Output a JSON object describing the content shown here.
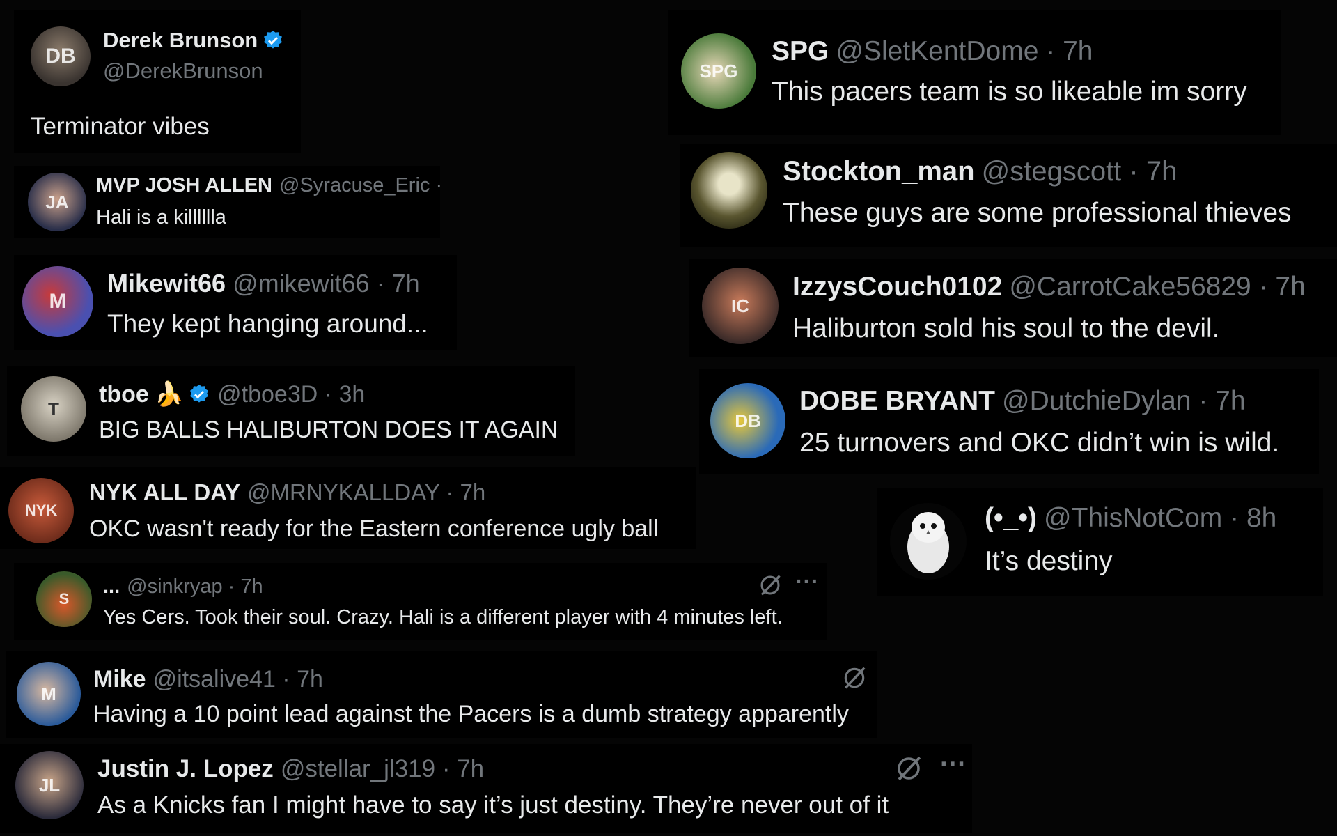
{
  "left": [
    {
      "name": "Derek Brunson",
      "handle": "@DerekBrunson",
      "text": "Terminator vibes",
      "verified": true,
      "avatar_color": "#4a4440"
    },
    {
      "name": "MVP JOSH ALLEN",
      "handle": "@Syracuse_Eric ·",
      "text": "Hali is a killlllla",
      "avatar_color": "#3a3f58"
    },
    {
      "name": "Mikewit66",
      "handle": "@mikewit66 · 7h",
      "text": "They kept hanging around...",
      "avatar_color": "#5a5fb8"
    },
    {
      "name": "tboe",
      "name_emoji": "🍌",
      "handle": "@tboe3D · 3h",
      "text": "BIG BALLS HALIBURTON DOES IT AGAIN",
      "verified": true,
      "avatar_color": "#b9b4a8"
    },
    {
      "name": "NYK ALL DAY",
      "handle": "@MRNYKALLDAY · 7h",
      "text": "OKC wasn't ready for the Eastern conference ugly ball",
      "avatar_color": "#8a3a2a"
    },
    {
      "name": "...",
      "handle": "@sinkryap · 7h",
      "text": "Yes Cers. Took their soul. Crazy. Hali is a different player with 4 minutes left.",
      "avatar_color": "#4d6b3a",
      "icons": {
        "grok": "grok-icon",
        "more": "···"
      }
    },
    {
      "name": "Mike",
      "handle": "@itsalive41 · 7h",
      "text": "Having a 10 point lead against the Pacers is a dumb strategy apparently",
      "avatar_color": "#2f5a8a",
      "icons": {
        "grok": "grok-icon"
      }
    },
    {
      "name": "Justin J. Lopez",
      "handle": "@stellar_jl319 · 7h",
      "text": "As a Knicks fan I might have to say it’s just destiny. They’re never out of it",
      "avatar_color": "#6a6258",
      "icons": {
        "grok": "grok-icon",
        "more": "···"
      }
    }
  ],
  "right": [
    {
      "name": "SPG",
      "handle": "@SletKentDome · 7h",
      "text": "This pacers team is so likeable im sorry",
      "avatar_color": "#6a8a4a"
    },
    {
      "name": "Stockton_man",
      "handle": "@stegscott · 7h",
      "text": "These guys are some professional thieves",
      "avatar_color": "#5a5630"
    },
    {
      "name": "IzzysCouch0102",
      "handle": "@CarrotCake56829 · 7h",
      "text": "Haliburton sold his soul to the devil.",
      "avatar_color": "#5a3a34"
    },
    {
      "name": "DOBE BRYANT",
      "handle": "@DutchieDylan · 7h",
      "text": "25 turnovers and OKC didn’t win is wild.",
      "avatar_color": "#2f6ea8"
    },
    {
      "name": "(•_•)",
      "handle": "@ThisNotCom · 8h",
      "text": "It’s destiny",
      "avatar_color": "#0a0a0a"
    }
  ],
  "colors": {
    "background": "#000000",
    "text": "#e7e9ea",
    "muted": "#71767b",
    "verified": "#1d9bf0"
  }
}
